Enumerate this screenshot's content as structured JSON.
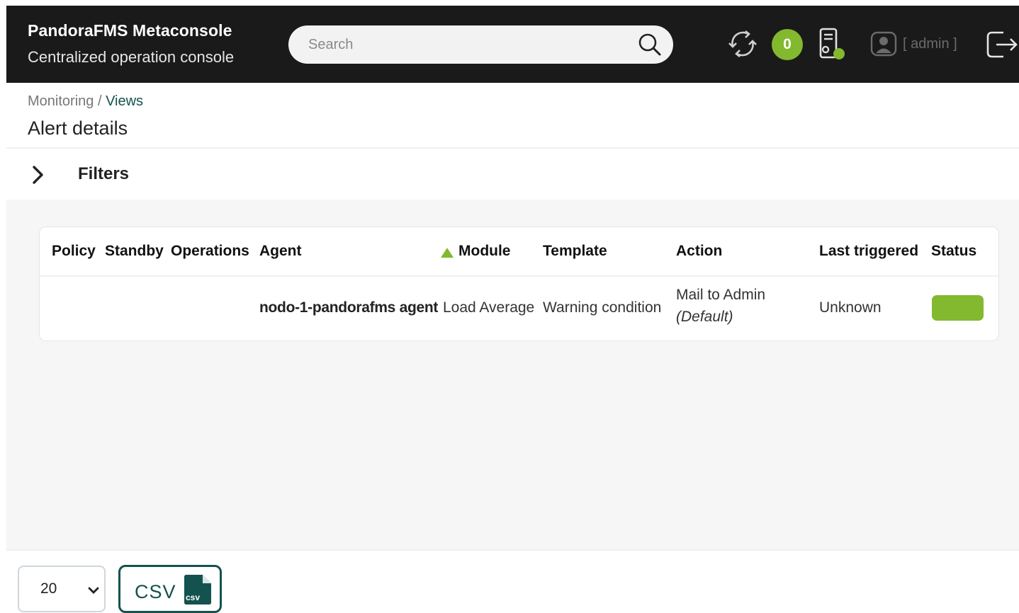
{
  "header": {
    "title": "PandoraFMS Metaconsole",
    "subtitle": "Centralized operation console",
    "search_placeholder": "Search",
    "notification_count": "0",
    "user": "[ admin ]"
  },
  "breadcrumb": {
    "parent": "Monitoring",
    "separator": " / ",
    "current": "Views"
  },
  "page_title": "Alert details",
  "filters_label": "Filters",
  "table": {
    "columns": [
      "Policy",
      "Standby",
      "Operations",
      "Agent",
      "Module",
      "Template",
      "Action",
      "Last triggered",
      "Status"
    ],
    "sorted_column": "Module",
    "rows": [
      {
        "policy": "",
        "standby": "",
        "operations": "",
        "agent": "nodo-1-pandorafms agent",
        "module": "Load Average",
        "template": "Warning condition",
        "action": "Mail to Admin",
        "action_note": "(Default)",
        "last_triggered": "Unknown",
        "status_color": "#82b92e"
      }
    ]
  },
  "footer": {
    "page_size": "20",
    "csv_label": "CSV",
    "csv_icon_text": "csv"
  },
  "colors": {
    "accent": "#82b92e",
    "brand_dark": "#14524f",
    "header_bg": "#1a1a1a"
  }
}
